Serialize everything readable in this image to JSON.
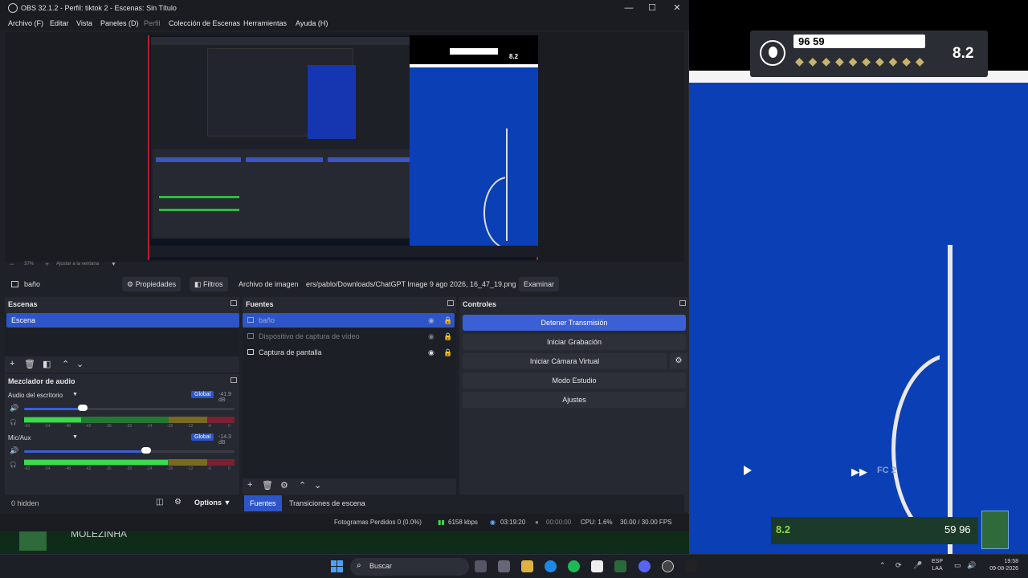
{
  "window": {
    "title": "OBS 32.1.2 - Perfil: tiktok 2 - Escenas: Sin Título",
    "controls": [
      "—",
      "☐",
      "✕"
    ]
  },
  "menu": [
    {
      "label": "Archivo (F)",
      "dim": false
    },
    {
      "label": "Editar",
      "dim": false
    },
    {
      "label": "Vista",
      "dim": false
    },
    {
      "label": "Paneles (D)",
      "dim": false
    },
    {
      "label": "Perfil",
      "dim": true
    },
    {
      "label": "Colección de Escenas",
      "dim": false
    },
    {
      "label": "Herramientas",
      "dim": false
    },
    {
      "label": "Ayuda (H)",
      "dim": false
    }
  ],
  "preview": {
    "zoom": "37%",
    "fit_label": "Ajustar a la ventana",
    "nested_hud_score": "8.2"
  },
  "source_toolbar": {
    "source_name": "baño",
    "properties": "Propiedades",
    "filters": "Filtros",
    "image_label": "Archivo de imagen",
    "image_path": "ers/pablo/Downloads/ChatGPT Image 9 ago 2026, 16_47_19.png",
    "browse": "Examinar"
  },
  "scenes": {
    "title": "Escenas",
    "items": [
      "Escena"
    ]
  },
  "sources": {
    "title": "Fuentes",
    "items": [
      {
        "label": "baño",
        "state": "sel",
        "visible_icon": "eye-slash"
      },
      {
        "label": "Dispositivo de captura de vídeo",
        "state": "dim",
        "visible_icon": "eye-slash"
      },
      {
        "label": "Captura de pantalla",
        "state": "normal",
        "visible_icon": "eye"
      }
    ]
  },
  "controls": {
    "title": "Controles",
    "stop_stream": "Detener Transmisión",
    "start_recording": "Iniciar Grabación",
    "start_virtual_cam": "Iniciar Cámara Virtual",
    "studio_mode": "Modo Estudio",
    "settings": "Ajustes"
  },
  "audio_mixer": {
    "title": "Mezclador de audio",
    "tick_labels": [
      "-60",
      "-54",
      "-48",
      "-42",
      "-36",
      "-30",
      "-24",
      "-18",
      "-12",
      "-6",
      "0"
    ],
    "channels": [
      {
        "name": "Audio del escritorio",
        "global": "Global",
        "db": "-41.9 dB",
        "volume": 0.28,
        "level": 0.3
      },
      {
        "name": "Mic/Aux",
        "global": "Global",
        "db": "-14.3 dB",
        "volume": 0.58,
        "level": 0.76
      }
    ]
  },
  "bottom": {
    "hidden_count": "0 hidden",
    "options": "Options",
    "tab_sources": "Fuentes",
    "tab_transitions": "Transiciones de escena"
  },
  "status": {
    "dropped_frames": "Fotogramas Perdidos 0 (0.0%)",
    "bitrate": "6158 kbps",
    "stream_time": "03:19:20",
    "rec_time": "00:00:00",
    "cpu": "CPU: 1.6%",
    "fps": "30.00 / 30.00 FPS"
  },
  "background_game": {
    "hud_value": "96",
    "hud_value_bold": "59",
    "hud_score": "8.2",
    "team_label": "FC 2",
    "bottom_rating": "8.2",
    "bottom_numbers": "59 96",
    "strip_name": "MOLEZINHA"
  },
  "taskbar": {
    "search": "Buscar",
    "lang_1": "ESP",
    "lang_2": "LAA",
    "time": "19:58",
    "date": "09-08-2026"
  },
  "colors": {
    "accent": "#2e55c8",
    "pitch": "#0a3fb5",
    "meter_green": "#3dd84e"
  }
}
